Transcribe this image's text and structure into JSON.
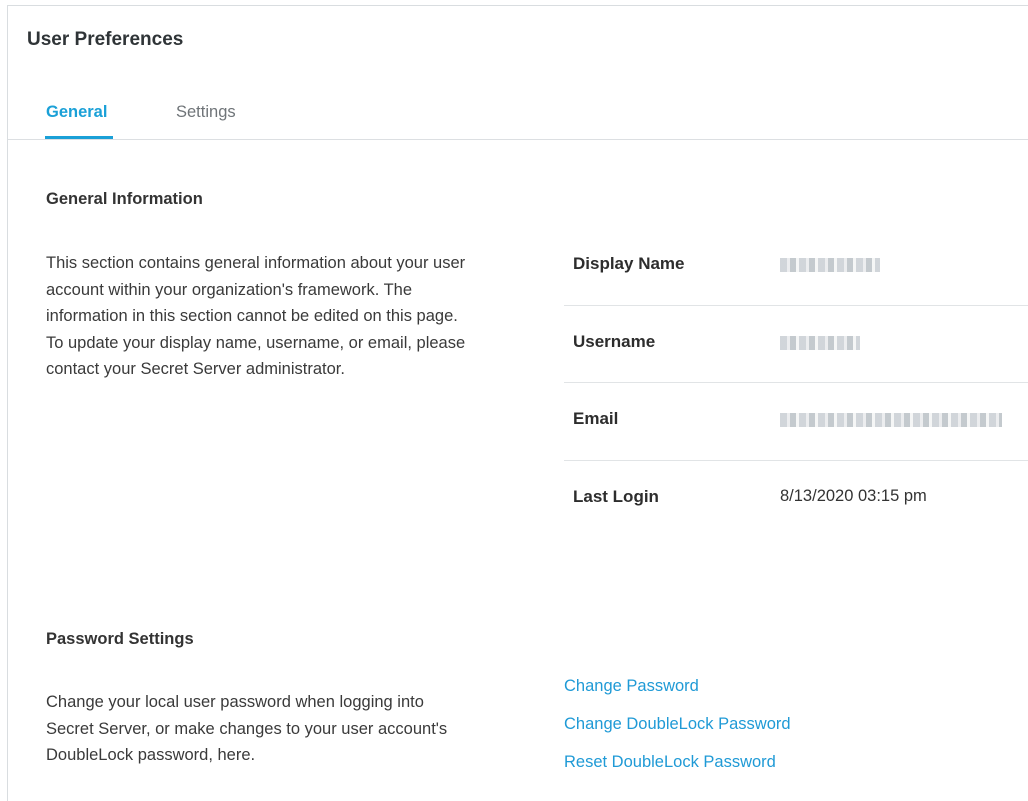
{
  "page": {
    "title": "User Preferences"
  },
  "tabs": [
    {
      "label": "General",
      "active": true
    },
    {
      "label": "Settings",
      "active": false
    }
  ],
  "general_information": {
    "heading": "General Information",
    "description": "This section contains general information about your user account within your organization's framework. The information in this section cannot be edited on this page. To update your display name, username, or email, please contact your Secret Server administrator.",
    "fields": [
      {
        "label": "Display Name",
        "value": "",
        "redacted": true
      },
      {
        "label": "Username",
        "value": "",
        "redacted": true
      },
      {
        "label": "Email",
        "value": "",
        "redacted": true
      },
      {
        "label": "Last Login",
        "value": "8/13/2020 03:15 pm",
        "redacted": false
      }
    ]
  },
  "password_settings": {
    "heading": "Password Settings",
    "description": "Change your local user password when logging into Secret Server, or make changes to your user account's DoubleLock password, here.",
    "links": [
      {
        "label": "Change Password"
      },
      {
        "label": "Change DoubleLock Password"
      },
      {
        "label": "Reset DoubleLock Password"
      }
    ]
  },
  "colors": {
    "accent": "#1aa0d7",
    "link": "#1f9ad6",
    "border": "#dcdfe2"
  }
}
